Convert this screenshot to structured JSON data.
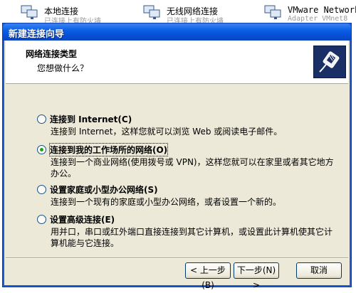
{
  "background": {
    "items": [
      {
        "label": "本地连接",
        "sub": "已连接上有防火墙"
      },
      {
        "label": "无线网络连接",
        "sub": "已连接上有防火墙"
      },
      {
        "label": "VMware Network",
        "sub": "Adapter VMnet8"
      }
    ]
  },
  "dialog": {
    "title": "新建连接向导",
    "header_title": "网络连接类型",
    "header_subtitle": "您想做什么？"
  },
  "options": [
    {
      "label": "连接到 Internet(C)",
      "description": "连接到 Internet，这样您就可以浏览 Web 或阅读电子邮件。",
      "checked": false
    },
    {
      "label": "连接到我的工作场所的网络(O)",
      "description": "连接到一个商业网络(使用拨号或 VPN)，这样您就可以在家里或者其它地方办公。",
      "checked": true
    },
    {
      "label": "设置家庭或小型办公网络(S)",
      "description": "连接到一个现有的家庭或小型办公网络，或者设置一个新的。",
      "checked": false
    },
    {
      "label": "设置高级连接(E)",
      "description": "用并口，串口或红外端口直接连接到其它计算机，或设置此计算机使其它计算机能与它连接。",
      "checked": false
    }
  ],
  "buttons": {
    "back": "< 上一步(B)",
    "next": "下一步(N) >",
    "cancel": "取消"
  },
  "icons": {
    "header": "network-cable-icon",
    "connection": "network-connection-icon"
  },
  "colors": {
    "titlebar": "#0a5fe6",
    "dialog_bg": "#ece9d8",
    "radio_dot": "#21a121"
  }
}
